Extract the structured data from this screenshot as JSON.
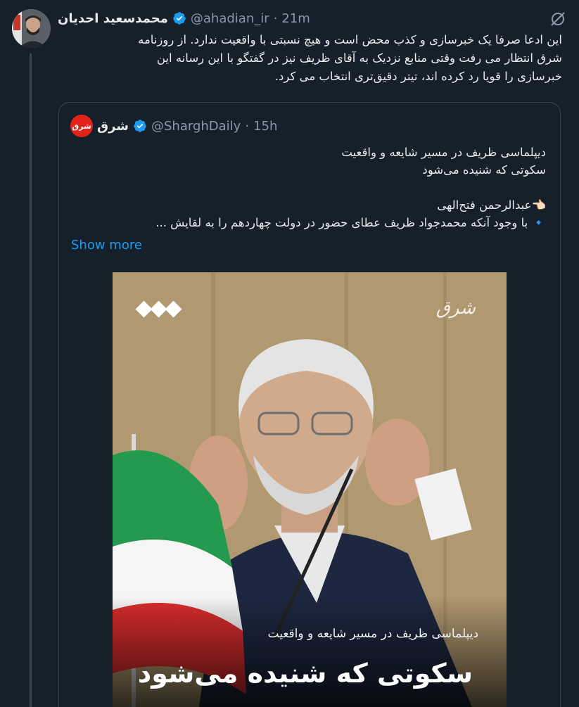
{
  "tweet": {
    "display_name": "محمدسعید احدیان",
    "handle": "@ahadian_ir",
    "separator": "·",
    "time": "21m",
    "lines": [
      "این ادعا صرفا یک خبرسازی و کذب محض است و  هیچ نسبتی با واقعیت ندارد. از روزنامه",
      "شرق انتظار می رفت وقتی منابع نزدیک به آقای ظریف نیز در گفتگو با این رسانه  این",
      "خبرسازی را قویا رد کرده اند، تیتر دقیق‌تری انتخاب می کرد."
    ]
  },
  "quote": {
    "display_name": "شرق",
    "avatar_text": "شرق",
    "handle": "@SharghDaily",
    "separator": "·",
    "time": "15h",
    "lines": [
      "دیپلماسی ظریف در مسیر شایعه و واقعیت",
      "سکوتی که شنیده می‌شود",
      "👈🏻عبدالرحمن فتح‌الهی",
      "🔹 با وجود آنکه محمدجواد ظریف عطای حضور در دولت چهاردهم را به لقایش ..."
    ],
    "show_more": "Show more",
    "media": {
      "logo": "شرق",
      "caption_small": "دیپلماسی ظریف در مسیر شایعه و واقعیت",
      "caption_big": "سکوتی که شنیده می‌شود"
    }
  },
  "colors": {
    "background": "#15202b",
    "accent": "#1d9bf0",
    "secondary_text": "#8b98a5",
    "border": "#38444d"
  },
  "icons": [
    "verified-badge-icon",
    "hide-icon",
    "point-left-emoji",
    "diamond-emoji"
  ]
}
